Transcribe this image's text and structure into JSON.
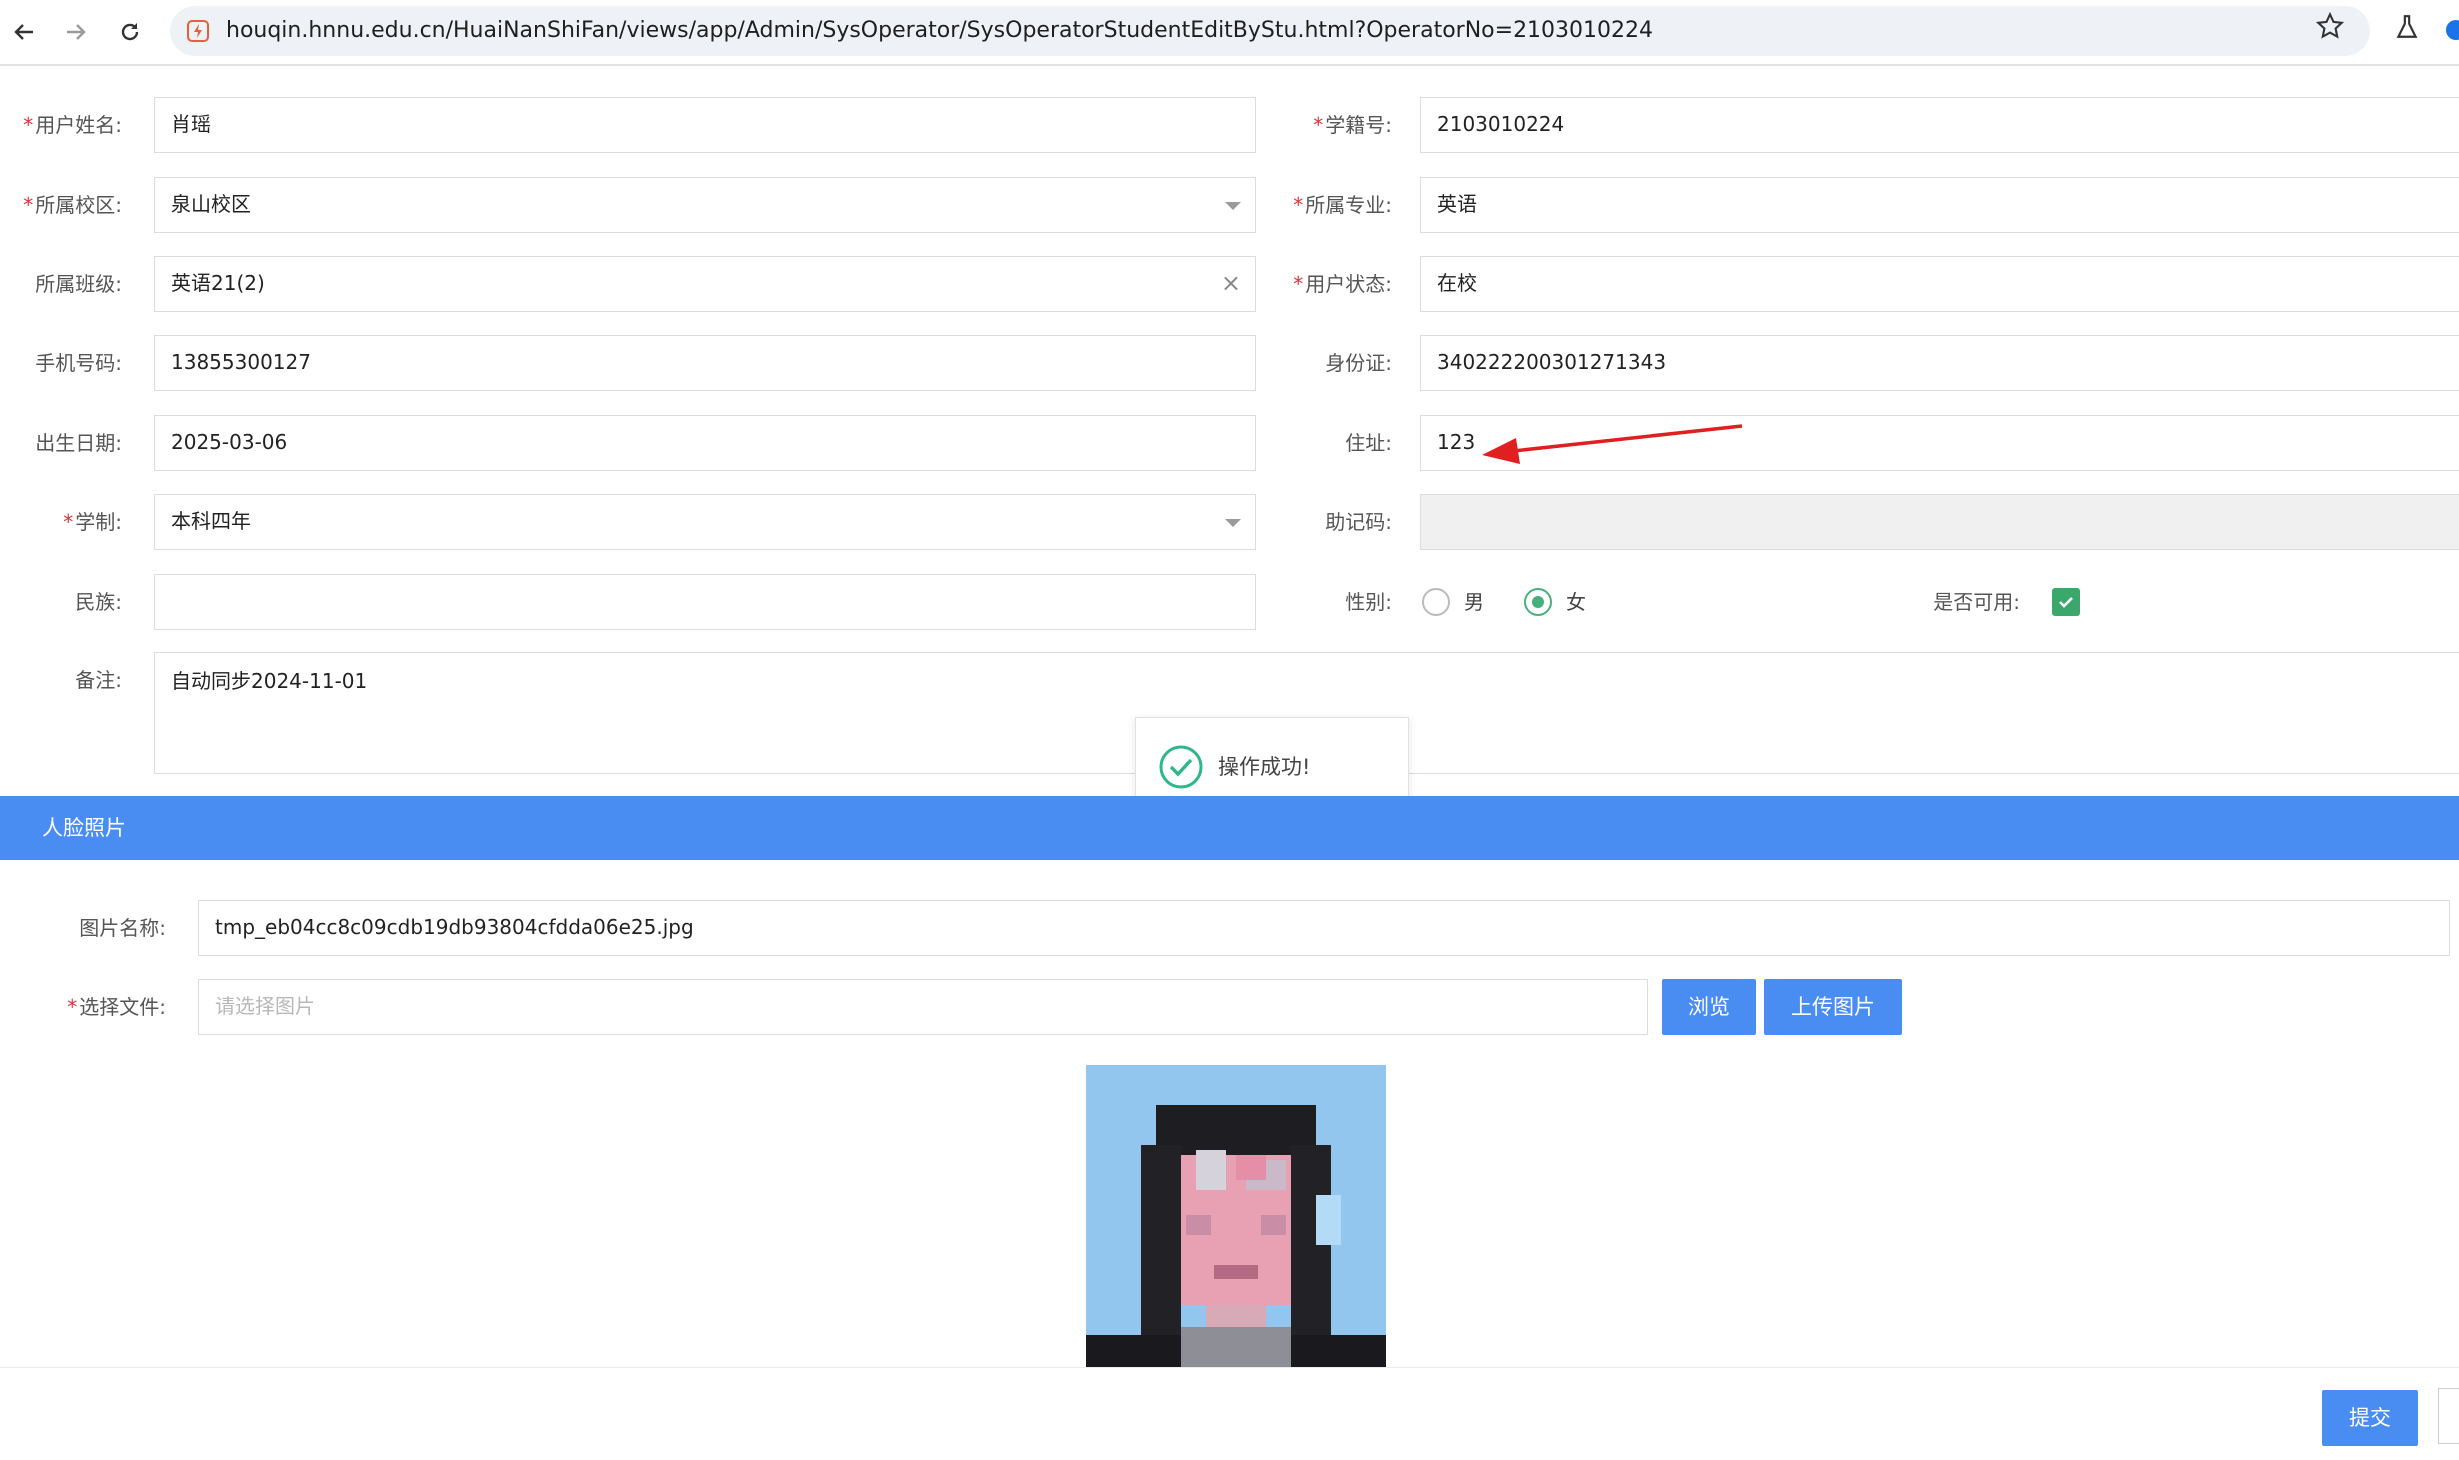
{
  "browser": {
    "url": "houqin.hnnu.edu.cn/HuaiNanShiFan/views/app/Admin/SysOperator/SysOperatorStudentEditByStu.html?OperatorNo=2103010224"
  },
  "form": {
    "name": {
      "label": "用户姓名:",
      "required": true,
      "value": "肖瑶"
    },
    "student_no": {
      "label": "学籍号:",
      "required": true,
      "value": "2103010224"
    },
    "campus": {
      "label": "所属校区:",
      "required": true,
      "value": "泉山校区"
    },
    "major": {
      "label": "所属专业:",
      "required": true,
      "value": "英语"
    },
    "class": {
      "label": "所属班级:",
      "required": false,
      "value": "英语21(2)"
    },
    "status": {
      "label": "用户状态:",
      "required": true,
      "value": "在校"
    },
    "phone": {
      "label": "手机号码:",
      "required": false,
      "value": "13855300127"
    },
    "id_card": {
      "label": "身份证:",
      "required": false,
      "value": "340222200301271343"
    },
    "birth_date": {
      "label": "出生日期:",
      "required": false,
      "value": "2025-03-06"
    },
    "address": {
      "label": "住址:",
      "required": false,
      "value": "123"
    },
    "program_length": {
      "label": "学制:",
      "required": true,
      "value": "本科四年"
    },
    "mnemonic": {
      "label": "助记码:",
      "required": false,
      "value": ""
    },
    "ethnicity": {
      "label": "民族:",
      "required": false,
      "value": ""
    },
    "gender": {
      "label": "性别:",
      "options": [
        "男",
        "女"
      ],
      "selected": "女"
    },
    "enabled": {
      "label": "是否可用:",
      "checked": true
    },
    "remark": {
      "label": "备注:",
      "value": "自动同步2024-11-01"
    }
  },
  "toast": {
    "message": "操作成功!"
  },
  "face_section": {
    "title": "人脸照片",
    "image_name": {
      "label": "图片名称:",
      "value": "tmp_eb04cc8c09cdb19db93804cfdda06e25.jpg"
    },
    "file": {
      "label": "选择文件:",
      "required": true,
      "placeholder": "请选择图片"
    },
    "browse_label": "浏览",
    "upload_label": "上传图片"
  },
  "footer": {
    "submit_label": "提交"
  },
  "colors": {
    "primary": "#4a8df2",
    "success": "#47b07a",
    "required": "#e0303a",
    "annotation": "#e02020"
  },
  "icons": [
    "back-arrow-icon",
    "forward-arrow-icon",
    "reload-icon",
    "site-icon",
    "star-icon",
    "labs-flask-icon",
    "check-circle-icon",
    "checkmark-icon",
    "dropdown-caret-icon",
    "clear-icon"
  ]
}
